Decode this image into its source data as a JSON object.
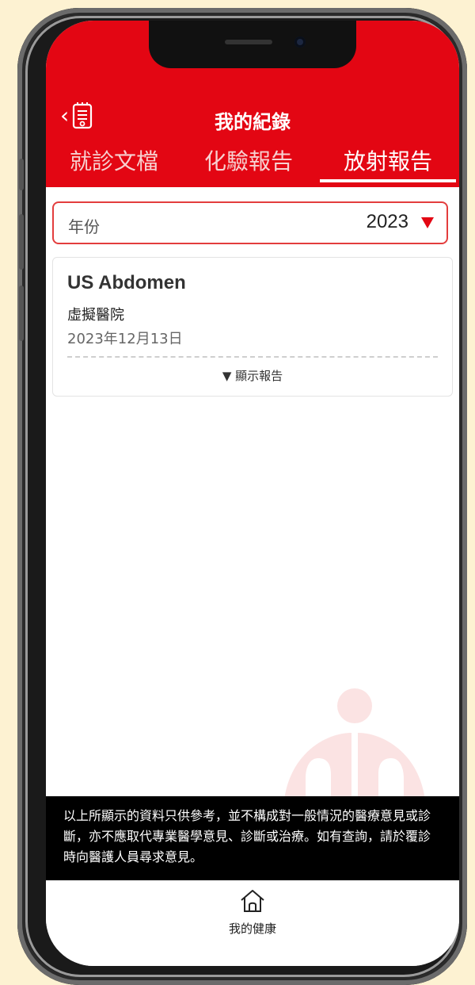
{
  "header": {
    "title": "我的紀錄",
    "back_icon": "back-chevron-icon"
  },
  "tabs": [
    {
      "label": "就診文檔",
      "active": false
    },
    {
      "label": "化驗報告",
      "active": false
    },
    {
      "label": "放射報告",
      "active": true
    }
  ],
  "year_filter": {
    "label": "年份",
    "value": "2023"
  },
  "records": [
    {
      "exam": "US Abdomen",
      "hospital": "虛擬醫院",
      "date": "2023年12月13日",
      "toggle_label": "▼ 顯示報告"
    }
  ],
  "disclaimer": "以上所顯示的資料只供參考，並不構成對一般情況的醫療意見或診斷，亦不應取代專業醫學意見、診斷或治療。如有查詢，請於覆診時向醫護人員尋求意見。",
  "bottom_nav": {
    "home_label": "我的健康"
  },
  "colors": {
    "brand_red": "#e30613",
    "background": "#fdf2d2"
  }
}
